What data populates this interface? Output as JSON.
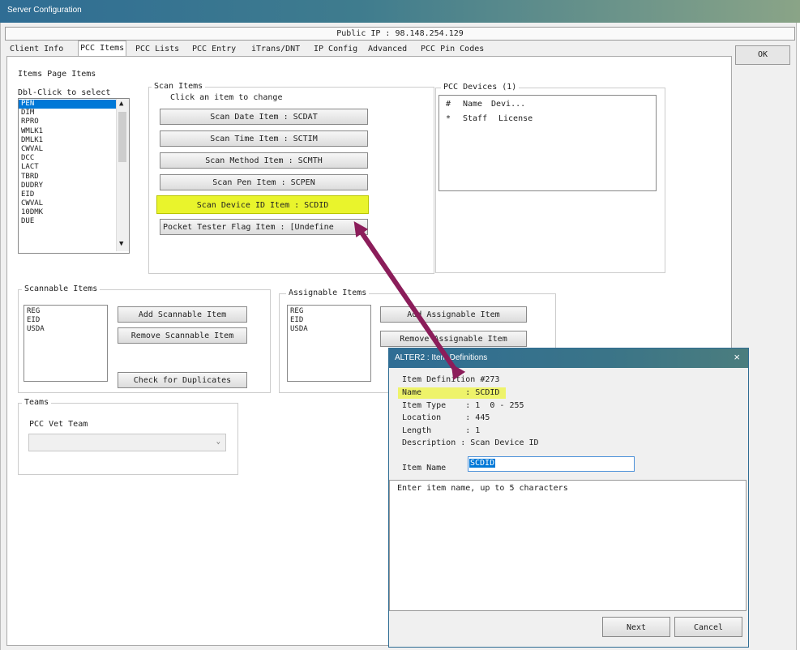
{
  "window": {
    "title": "Server Configuration",
    "public_ip": "Public IP : 98.148.254.129",
    "ok_label": "OK"
  },
  "tabs": [
    {
      "label": "Client Info"
    },
    {
      "label": "PCC Items"
    },
    {
      "label": "PCC Lists"
    },
    {
      "label": "PCC Entry"
    },
    {
      "label": "iTrans/DNT"
    },
    {
      "label": "IP Config"
    },
    {
      "label": "Advanced"
    },
    {
      "label": "PCC Pin Codes"
    }
  ],
  "items_page": {
    "group_label": "Items Page Items",
    "hint": "Dbl-Click to select",
    "list": [
      "PEN",
      "DIM",
      "RPRO",
      "WMLK1",
      "DMLK1",
      "CWVAL",
      "DCC",
      "LACT",
      "TBRD",
      "DUDRY",
      "EID",
      "CWVAL",
      "10DMK",
      "DUE"
    ],
    "selected": "PEN"
  },
  "scan_items": {
    "group_label": "Scan Items",
    "hint": "Click an item to change",
    "buttons": [
      "Scan Date Item : SCDAT",
      "Scan Time Item : SCTIM",
      "Scan Method Item : SCMTH",
      "Scan Pen Item : SCPEN",
      "Scan Device ID Item : SCDID",
      "Pocket Tester Flag Item : [Undefine"
    ]
  },
  "pcc_devices": {
    "group_label": "PCC Devices (1)",
    "columns": [
      "#",
      "Name",
      "Devi..."
    ],
    "rows": [
      [
        "*",
        "Staff",
        "License"
      ]
    ]
  },
  "scannable": {
    "group_label": "Scannable Items",
    "list": [
      "REG",
      "EID",
      "USDA"
    ],
    "add": "Add Scannable Item",
    "remove": "Remove Scannable Item",
    "check": "Check for Duplicates"
  },
  "assignable": {
    "group_label": "Assignable Items",
    "list": [
      "REG",
      "EID",
      "USDA"
    ],
    "add": "Add Assignable Item",
    "remove": "Remove Assignable Item"
  },
  "teams": {
    "group_label": "Teams",
    "field_label": "PCC Vet Team",
    "value": ""
  },
  "dialog": {
    "title": "ALTER2 : Item Definitions",
    "close": "×",
    "lines": [
      "Item Definition #273",
      "Name         : SCDID",
      "Item Type    : 1  0 - 255",
      "Location     : 445",
      "Length       : 1",
      "Description : Scan Device ID"
    ],
    "item_name_label": "Item Name",
    "item_name_value": "SCDID",
    "help_text": "Enter item name, up to 5 characters",
    "next": "Next",
    "cancel": "Cancel"
  },
  "colors": {
    "accent_highlight": "#e9f42c",
    "arrow": "#8b1d5a",
    "selection": "#0078d7",
    "titlebar": "#2f6d94"
  }
}
